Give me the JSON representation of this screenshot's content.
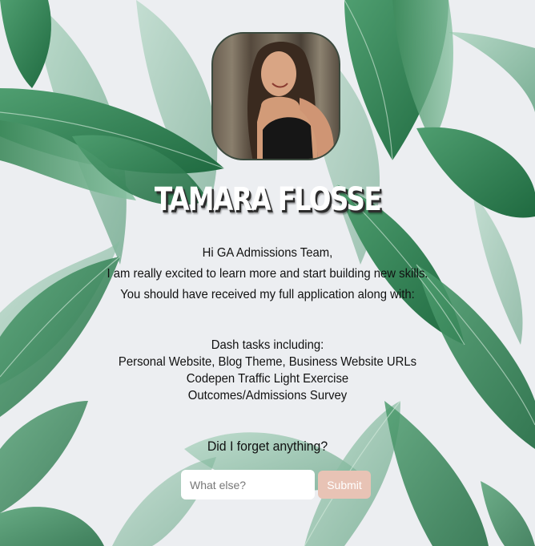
{
  "profile": {
    "name": "TAMARA FLOSSE"
  },
  "intro": {
    "line1": "Hi GA Admissions Team,",
    "line2": "I am really excited to learn more and start building new skills.",
    "line3": "You should have received my full application along with:"
  },
  "tasks": {
    "heading": "Dash tasks including:",
    "items": [
      "Personal Website, Blog Theme, Business Website URLs",
      "Codepen Traffic Light Exercise",
      "Outcomes/Admissions Survey"
    ]
  },
  "question": "Did I forget anything?",
  "form": {
    "placeholder": "What else?",
    "submit_label": "Submit"
  },
  "colors": {
    "background": "#eceef1",
    "leaf_dark": "#2e7a4c",
    "leaf_light": "#7fb89a",
    "submit_bg": "#e8c3b5"
  }
}
